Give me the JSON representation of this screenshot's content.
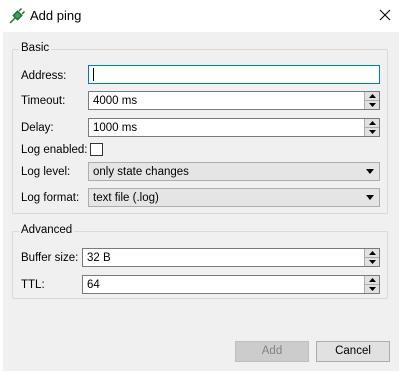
{
  "window": {
    "title": "Add ping",
    "title_icon": "plug-icon",
    "close_icon": "close-icon"
  },
  "basic": {
    "group_label": "Basic",
    "address": {
      "label": "Address:",
      "value": ""
    },
    "timeout": {
      "label": "Timeout:",
      "value": "4000 ms"
    },
    "delay": {
      "label": "Delay:",
      "value": "1000 ms"
    },
    "log_enabled": {
      "label": "Log enabled:",
      "checked": false
    },
    "log_level": {
      "label": "Log level:",
      "value": "only state changes"
    },
    "log_format": {
      "label": "Log format:",
      "value": "text file (.log)"
    }
  },
  "advanced": {
    "group_label": "Advanced",
    "buffer_size": {
      "label": "Buffer size:",
      "value": "32 B"
    },
    "ttl": {
      "label": "TTL:",
      "value": "64"
    }
  },
  "buttons": {
    "add": {
      "label": "Add",
      "enabled": false
    },
    "cancel": {
      "label": "Cancel",
      "enabled": true
    }
  },
  "colors": {
    "focus_border": "#0078d7",
    "dialog_background": "#f0f0f0"
  }
}
